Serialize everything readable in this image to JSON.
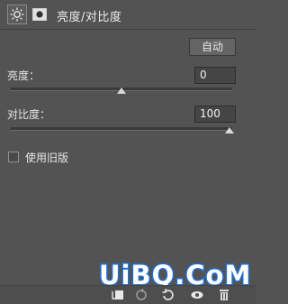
{
  "panel": {
    "title": "亮度/对比度",
    "auto_label": "自动",
    "brightness": {
      "label": "亮度：",
      "value": "0"
    },
    "contrast": {
      "label": "对比度：",
      "value": "100"
    },
    "legacy": {
      "label": "使用旧版",
      "checked": false
    }
  },
  "watermark": {
    "text": "UiBQ.CoM"
  },
  "colors": {
    "background": "#535353",
    "text": "#e6e6e6",
    "watermark_blue": "#1f6fd6"
  },
  "icons": [
    "adjustment-sun-icon",
    "layer-mask-icon",
    "clip-to-layer-icon",
    "view-previous-icon",
    "reset-icon",
    "visibility-eye-icon",
    "delete-trash-icon"
  ]
}
